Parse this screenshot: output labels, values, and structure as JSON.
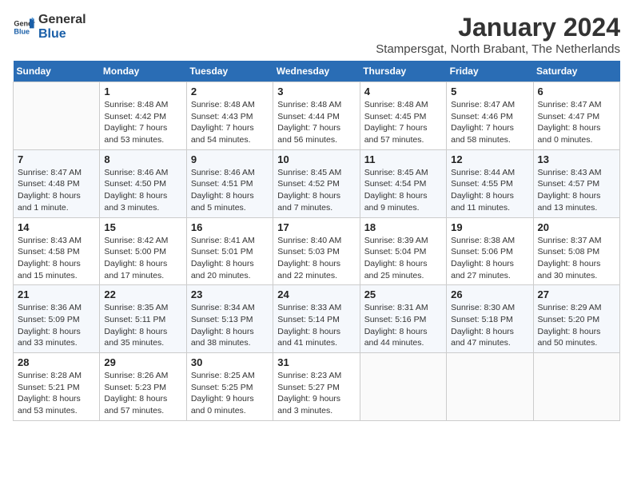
{
  "logo": {
    "line1": "General",
    "line2": "Blue"
  },
  "title": "January 2024",
  "subtitle": "Stampersgat, North Brabant, The Netherlands",
  "days_of_week": [
    "Sunday",
    "Monday",
    "Tuesday",
    "Wednesday",
    "Thursday",
    "Friday",
    "Saturday"
  ],
  "weeks": [
    [
      {
        "day": "",
        "info": ""
      },
      {
        "day": "1",
        "info": "Sunrise: 8:48 AM\nSunset: 4:42 PM\nDaylight: 7 hours\nand 53 minutes."
      },
      {
        "day": "2",
        "info": "Sunrise: 8:48 AM\nSunset: 4:43 PM\nDaylight: 7 hours\nand 54 minutes."
      },
      {
        "day": "3",
        "info": "Sunrise: 8:48 AM\nSunset: 4:44 PM\nDaylight: 7 hours\nand 56 minutes."
      },
      {
        "day": "4",
        "info": "Sunrise: 8:48 AM\nSunset: 4:45 PM\nDaylight: 7 hours\nand 57 minutes."
      },
      {
        "day": "5",
        "info": "Sunrise: 8:47 AM\nSunset: 4:46 PM\nDaylight: 7 hours\nand 58 minutes."
      },
      {
        "day": "6",
        "info": "Sunrise: 8:47 AM\nSunset: 4:47 PM\nDaylight: 8 hours\nand 0 minutes."
      }
    ],
    [
      {
        "day": "7",
        "info": "Sunrise: 8:47 AM\nSunset: 4:48 PM\nDaylight: 8 hours\nand 1 minute."
      },
      {
        "day": "8",
        "info": "Sunrise: 8:46 AM\nSunset: 4:50 PM\nDaylight: 8 hours\nand 3 minutes."
      },
      {
        "day": "9",
        "info": "Sunrise: 8:46 AM\nSunset: 4:51 PM\nDaylight: 8 hours\nand 5 minutes."
      },
      {
        "day": "10",
        "info": "Sunrise: 8:45 AM\nSunset: 4:52 PM\nDaylight: 8 hours\nand 7 minutes."
      },
      {
        "day": "11",
        "info": "Sunrise: 8:45 AM\nSunset: 4:54 PM\nDaylight: 8 hours\nand 9 minutes."
      },
      {
        "day": "12",
        "info": "Sunrise: 8:44 AM\nSunset: 4:55 PM\nDaylight: 8 hours\nand 11 minutes."
      },
      {
        "day": "13",
        "info": "Sunrise: 8:43 AM\nSunset: 4:57 PM\nDaylight: 8 hours\nand 13 minutes."
      }
    ],
    [
      {
        "day": "14",
        "info": "Sunrise: 8:43 AM\nSunset: 4:58 PM\nDaylight: 8 hours\nand 15 minutes."
      },
      {
        "day": "15",
        "info": "Sunrise: 8:42 AM\nSunset: 5:00 PM\nDaylight: 8 hours\nand 17 minutes."
      },
      {
        "day": "16",
        "info": "Sunrise: 8:41 AM\nSunset: 5:01 PM\nDaylight: 8 hours\nand 20 minutes."
      },
      {
        "day": "17",
        "info": "Sunrise: 8:40 AM\nSunset: 5:03 PM\nDaylight: 8 hours\nand 22 minutes."
      },
      {
        "day": "18",
        "info": "Sunrise: 8:39 AM\nSunset: 5:04 PM\nDaylight: 8 hours\nand 25 minutes."
      },
      {
        "day": "19",
        "info": "Sunrise: 8:38 AM\nSunset: 5:06 PM\nDaylight: 8 hours\nand 27 minutes."
      },
      {
        "day": "20",
        "info": "Sunrise: 8:37 AM\nSunset: 5:08 PM\nDaylight: 8 hours\nand 30 minutes."
      }
    ],
    [
      {
        "day": "21",
        "info": "Sunrise: 8:36 AM\nSunset: 5:09 PM\nDaylight: 8 hours\nand 33 minutes."
      },
      {
        "day": "22",
        "info": "Sunrise: 8:35 AM\nSunset: 5:11 PM\nDaylight: 8 hours\nand 35 minutes."
      },
      {
        "day": "23",
        "info": "Sunrise: 8:34 AM\nSunset: 5:13 PM\nDaylight: 8 hours\nand 38 minutes."
      },
      {
        "day": "24",
        "info": "Sunrise: 8:33 AM\nSunset: 5:14 PM\nDaylight: 8 hours\nand 41 minutes."
      },
      {
        "day": "25",
        "info": "Sunrise: 8:31 AM\nSunset: 5:16 PM\nDaylight: 8 hours\nand 44 minutes."
      },
      {
        "day": "26",
        "info": "Sunrise: 8:30 AM\nSunset: 5:18 PM\nDaylight: 8 hours\nand 47 minutes."
      },
      {
        "day": "27",
        "info": "Sunrise: 8:29 AM\nSunset: 5:20 PM\nDaylight: 8 hours\nand 50 minutes."
      }
    ],
    [
      {
        "day": "28",
        "info": "Sunrise: 8:28 AM\nSunset: 5:21 PM\nDaylight: 8 hours\nand 53 minutes."
      },
      {
        "day": "29",
        "info": "Sunrise: 8:26 AM\nSunset: 5:23 PM\nDaylight: 8 hours\nand 57 minutes."
      },
      {
        "day": "30",
        "info": "Sunrise: 8:25 AM\nSunset: 5:25 PM\nDaylight: 9 hours\nand 0 minutes."
      },
      {
        "day": "31",
        "info": "Sunrise: 8:23 AM\nSunset: 5:27 PM\nDaylight: 9 hours\nand 3 minutes."
      },
      {
        "day": "",
        "info": ""
      },
      {
        "day": "",
        "info": ""
      },
      {
        "day": "",
        "info": ""
      }
    ]
  ]
}
